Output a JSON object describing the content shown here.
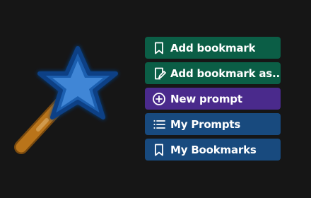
{
  "colors": {
    "background": "#161616",
    "bookmark_green": "#0b5e46",
    "prompt_purple": "#4a2a8c",
    "list_blue": "#184a7e",
    "star_blue": "#2f78c8",
    "wand_brown": "#b9741a"
  },
  "illustration": {
    "icon": "magic-wand-star-icon"
  },
  "menu": {
    "items": [
      {
        "label": "Add bookmark",
        "icon": "bookmark-icon",
        "color": "#0b5e46"
      },
      {
        "label": "Add bookmark as...",
        "icon": "bookmark-edit-icon",
        "color": "#0b5e46"
      },
      {
        "label": "New prompt",
        "icon": "plus-circle-icon",
        "color": "#4a2a8c"
      },
      {
        "label": "My Prompts",
        "icon": "list-icon",
        "color": "#184a7e"
      },
      {
        "label": "My Bookmarks",
        "icon": "bookmark-icon",
        "color": "#184a7e"
      }
    ]
  }
}
